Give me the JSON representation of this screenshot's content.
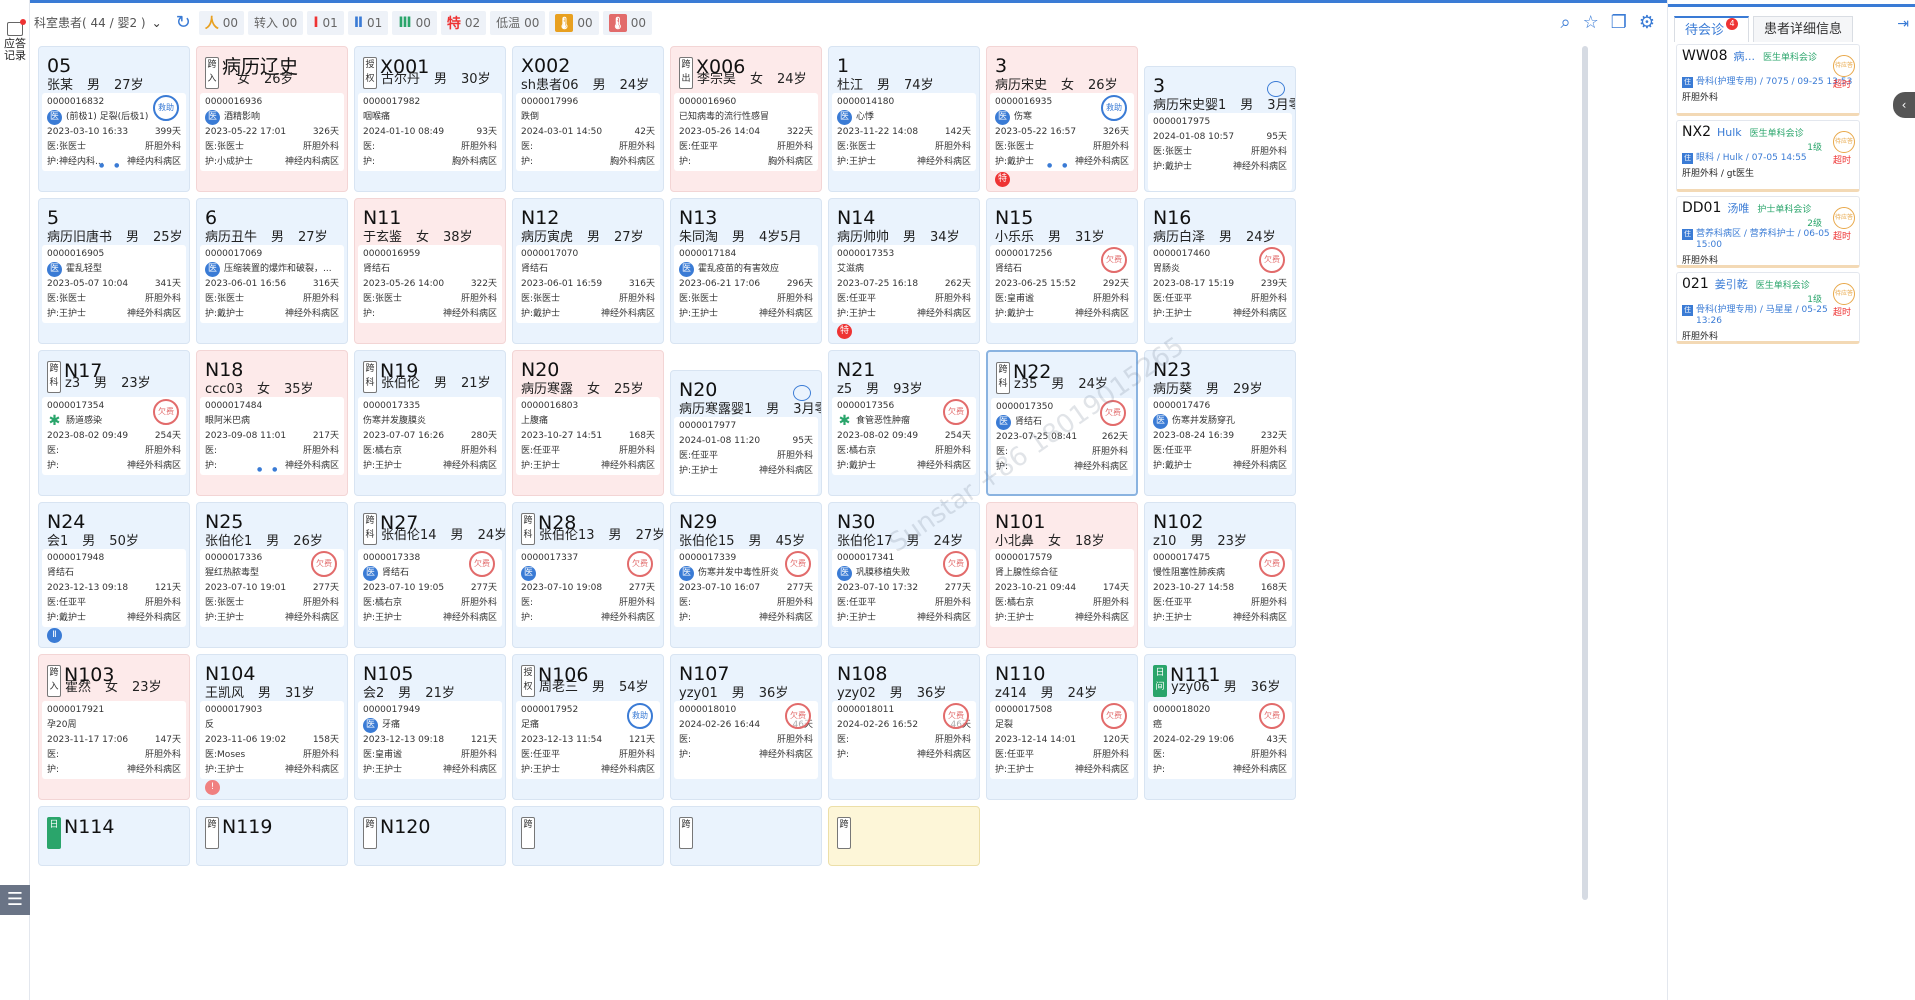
{
  "app": {
    "left_record_label": "应答记录",
    "filter_label": "科室患者( 44 / 婴2 )"
  },
  "stats": [
    {
      "icon": "人",
      "color": "#e8a020",
      "value": "00",
      "name": "stat-people"
    },
    {
      "label": "转入",
      "value": "00",
      "name": "stat-transfer-in"
    },
    {
      "icon": "Ⅰ",
      "color": "#e33",
      "value": "01",
      "name": "stat-level1"
    },
    {
      "icon": "Ⅱ",
      "color": "#3a7bd5",
      "value": "01",
      "name": "stat-level2"
    },
    {
      "icon": "Ⅲ",
      "color": "#2aa56b",
      "value": "00",
      "name": "stat-level3"
    },
    {
      "icon": "特",
      "color": "#e33",
      "value": "02",
      "name": "stat-special"
    },
    {
      "label": "低温",
      "value": "00",
      "name": "stat-low-temp"
    },
    {
      "icon": "🌡",
      "box": "#e8a020",
      "value": "00",
      "name": "stat-temp-yellow"
    },
    {
      "icon": "🌡",
      "box": "#e26b6b",
      "value": "00",
      "name": "stat-temp-red"
    }
  ],
  "right_panel": {
    "tab_pending": "待会诊",
    "tab_pending_badge": "4",
    "tab_detail": "患者详细信息",
    "consultations": [
      {
        "id": "WW08",
        "name": "病...",
        "type": "医生单科会诊",
        "level": "",
        "status": "待应答",
        "dept": "骨科(护理专用) / 7075 / 09-25 13:53",
        "overtime": "超时",
        "ward": "肝胆外科"
      },
      {
        "id": "NX2",
        "name": "Hulk",
        "type": "医生单科会诊",
        "level": "1级",
        "status": "待应答",
        "dept": "眼科 / Hulk / 07-05 14:55",
        "overtime": "超时",
        "ward": "肝胆外科 / gt医生"
      },
      {
        "id": "DD01",
        "name": "汤唯",
        "type": "护士单科会诊",
        "level": "2级",
        "status": "待应答",
        "dept": "营养科病区 / 营养科护士 / 06-05 15:00",
        "overtime": "超时",
        "ward": "肝胆外科"
      },
      {
        "id": "021",
        "name": "姜引乾",
        "type": "医生单科会诊",
        "level": "1级",
        "status": "待应答",
        "dept": "骨科(护理专用) / 马星星 / 05-25 13:26",
        "overtime": "超时",
        "ward": "肝胆外科"
      }
    ]
  },
  "watermark": "Sunstar +86 18019015265",
  "beds": [
    {
      "bed": "05",
      "name": "张某",
      "sex": "男",
      "age": "27岁",
      "id": "0000016832",
      "dx": "(前极1) 足裂(后极1)",
      "badge": "b",
      "date": "2023-03-10 16:33",
      "days": "399天",
      "doc": "张医士",
      "dept": "肝胆外科",
      "nurse": "神经内科...",
      "ward": "神经内科病区",
      "color": "blue",
      "stamp": "救助",
      "stampColor": "blue",
      "dots": true
    },
    {
      "bed": "病历辽史",
      "tag": "跨入",
      "name": "",
      "sex": "女",
      "age": "26岁",
      "id": "0000016936",
      "dx": "酒精影响",
      "badge": "b",
      "date": "2023-05-22 17:01",
      "days": "326天",
      "doc": "张医士",
      "dept": "肝胆外科",
      "nurse": "小成护士",
      "ward": "神经内科病区",
      "color": "pink"
    },
    {
      "bed": "X001",
      "tag": "授权",
      "tagGreen": false,
      "name": "古尔丹",
      "sex": "男",
      "age": "30岁",
      "id": "0000017982",
      "dx": "咽喉痛",
      "date": "2024-01-10 08:49",
      "days": "93天",
      "doc": "",
      "dept": "肝胆外科",
      "nurse": "",
      "ward": "胸外科病区",
      "color": "blue"
    },
    {
      "bed": "X002",
      "name": "sh患者06",
      "sex": "男",
      "age": "24岁",
      "id": "0000017996",
      "dx": "跌倒",
      "date": "2024-03-01 14:50",
      "days": "42天",
      "doc": "",
      "dept": "肝胆外科",
      "nurse": "",
      "ward": "胸外科病区",
      "color": "blue"
    },
    {
      "bed": "X006",
      "tag": "跨出",
      "name": "李宗昊",
      "sex": "女",
      "age": "24岁",
      "id": "0000016960",
      "dx": "已知病毒的流行性感冒",
      "date": "2023-05-26 14:04",
      "days": "322天",
      "doc": "任亚平",
      "dept": "肝胆外科",
      "nurse": "",
      "ward": "胸外科病区",
      "color": "pink"
    },
    {
      "bed": "1",
      "name": "杜江",
      "sex": "男",
      "age": "74岁",
      "id": "0000014180",
      "dx": "心悸",
      "badge": "b",
      "date": "2023-11-22 14:08",
      "days": "142天",
      "doc": "张医士",
      "dept": "肝胆外科",
      "nurse": "王护士",
      "ward": "神经外科病区",
      "color": "blue"
    },
    {
      "bed": "3",
      "name": "病历宋史",
      "sex": "女",
      "age": "26岁",
      "id": "0000016935",
      "dx": "伤寒",
      "badge": "b",
      "date": "2023-05-22 16:57",
      "days": "326天",
      "doc": "张医士",
      "dept": "肝胆外科",
      "nurse": "戴护士",
      "ward": "神经外科病区",
      "color": "pink",
      "stamp": "救助",
      "stampColor": "blue",
      "foot": "特",
      "footColor": "red",
      "dots": true
    },
    {
      "bed": "3",
      "name": "病历宋史婴1",
      "sex": "男",
      "age": "3月零4天",
      "id": "0000017975",
      "dx": "",
      "date": "2024-01-08 10:57",
      "days": "95天",
      "doc": "张医士",
      "dept": "肝胆外科",
      "nurse": "戴护士",
      "ward": "神经外科病区",
      "color": "blue",
      "baby": true,
      "offset": true
    },
    {
      "bed": "5",
      "name": "病历旧唐书",
      "sex": "男",
      "age": "25岁",
      "id": "0000016905",
      "dx": "霍乱轻型",
      "badge": "b",
      "date": "2023-05-07 10:04",
      "days": "341天",
      "doc": "张医士",
      "dept": "肝胆外科",
      "nurse": "王护士",
      "ward": "神经外科病区",
      "color": "blue"
    },
    {
      "bed": "6",
      "name": "病历丑牛",
      "sex": "男",
      "age": "27岁",
      "id": "0000017069",
      "dx": "压缩装置的爆炸和破裂，...",
      "badge": "b",
      "date": "2023-06-01 16:56",
      "days": "316天",
      "doc": "张医士",
      "dept": "肝胆外科",
      "nurse": "戴护士",
      "ward": "神经外科病区",
      "color": "blue"
    },
    {
      "bed": "N11",
      "name": "于玄鉴",
      "sex": "女",
      "age": "38岁",
      "id": "0000016959",
      "dx": "肾结石",
      "date": "2023-05-26 14:00",
      "days": "322天",
      "doc": "张医士",
      "dept": "肝胆外科",
      "nurse": "",
      "ward": "神经外科病区",
      "color": "pink"
    },
    {
      "bed": "N12",
      "name": "病历寅虎",
      "sex": "男",
      "age": "27岁",
      "id": "0000017070",
      "dx": "肾结石",
      "date": "2023-06-01 16:59",
      "days": "316天",
      "doc": "张医士",
      "dept": "肝胆外科",
      "nurse": "戴护士",
      "ward": "神经外科病区",
      "color": "blue"
    },
    {
      "bed": "N13",
      "name": "朱同淘",
      "sex": "男",
      "age": "4岁5月",
      "id": "0000017184",
      "dx": "霍乱疫苗的有害效应",
      "badge": "b",
      "date": "2023-06-21 17:06",
      "days": "296天",
      "doc": "张医士",
      "dept": "肝胆外科",
      "nurse": "王护士",
      "ward": "神经外科病区",
      "color": "blue"
    },
    {
      "bed": "N14",
      "name": "病历帅帅",
      "sex": "男",
      "age": "34岁",
      "id": "0000017353",
      "dx": "艾滋病",
      "date": "2023-07-25 16:18",
      "days": "262天",
      "doc": "任亚平",
      "dept": "肝胆外科",
      "nurse": "王护士",
      "ward": "神经外科病区",
      "color": "blue",
      "foot": "特",
      "footColor": "red"
    },
    {
      "bed": "N15",
      "name": "小乐乐",
      "sex": "男",
      "age": "31岁",
      "id": "0000017256",
      "dx": "肾结石",
      "date": "2023-06-25 15:52",
      "days": "292天",
      "doc": "皇甫谧",
      "dept": "肝胆外科",
      "nurse": "戴护士",
      "ward": "神经外科病区",
      "color": "blue",
      "stamp": "欠费"
    },
    {
      "bed": "N16",
      "name": "病历白泽",
      "sex": "男",
      "age": "24岁",
      "id": "0000017460",
      "dx": "胃肠炎",
      "date": "2023-08-17 15:19",
      "days": "239天",
      "doc": "任亚平",
      "dept": "肝胆外科",
      "nurse": "王护士",
      "ward": "神经外科病区",
      "color": "blue",
      "stamp": "欠费"
    },
    {
      "bed": "N17",
      "tag": "跨科",
      "name": "z3",
      "sex": "男",
      "age": "23岁",
      "id": "0000017354",
      "dx": "肠道感染",
      "badge": "g",
      "date": "2023-08-02 09:49",
      "days": "254天",
      "doc": "",
      "dept": "肝胆外科",
      "nurse": "",
      "ward": "神经外科病区",
      "color": "blue",
      "stamp": "欠费"
    },
    {
      "bed": "N18",
      "name": "ccc03",
      "sex": "女",
      "age": "35岁",
      "id": "0000017484",
      "dx": "眼阿米巴病",
      "date": "2023-09-08 11:01",
      "days": "217天",
      "doc": "",
      "dept": "肝胆外科",
      "nurse": "",
      "ward": "神经外科病区",
      "color": "pink",
      "dots": true
    },
    {
      "bed": "N19",
      "tag": "跨科",
      "name": "张伯伦",
      "sex": "男",
      "age": "21岁",
      "id": "0000017335",
      "dx": "伤寒并发腹膜炎",
      "date": "2023-07-07 16:26",
      "days": "280天",
      "doc": "橘右京",
      "dept": "肝胆外科",
      "nurse": "王护士",
      "ward": "神经外科病区",
      "color": "blue"
    },
    {
      "bed": "N20",
      "name": "病历寒露",
      "sex": "女",
      "age": "25岁",
      "id": "0000016803",
      "dx": "上腹痛",
      "date": "2023-10-27 14:51",
      "days": "168天",
      "doc": "任亚平",
      "dept": "肝胆外科",
      "nurse": "王护士",
      "ward": "神经外科病区",
      "color": "pink"
    },
    {
      "bed": "N20",
      "name": "病历寒露婴1",
      "sex": "男",
      "age": "3月零4天",
      "id": "0000017977",
      "dx": "",
      "date": "2024-01-08 11:20",
      "days": "95天",
      "doc": "任亚平",
      "dept": "肝胆外科",
      "nurse": "王护士",
      "ward": "神经外科病区",
      "color": "blue",
      "baby": true,
      "offset": true
    },
    {
      "bed": "N21",
      "name": "z5",
      "sex": "男",
      "age": "93岁",
      "id": "0000017356",
      "dx": "食管恶性肿瘤",
      "badge": "g",
      "date": "2023-08-02 09:49",
      "days": "254天",
      "doc": "橘右京",
      "dept": "肝胆外科",
      "nurse": "戴护士",
      "ward": "神经外科病区",
      "color": "blue",
      "stamp": "欠费"
    },
    {
      "bed": "N22",
      "tag": "跨科",
      "name": "z35",
      "sex": "男",
      "age": "24岁",
      "id": "0000017350",
      "dx": "肾结石",
      "badge": "b",
      "date": "2023-07-25 08:41",
      "days": "262天",
      "doc": "",
      "dept": "肝胆外科",
      "nurse": "",
      "ward": "神经外科病区",
      "color": "blue",
      "stamp": "欠费",
      "selected": true
    },
    {
      "bed": "N23",
      "name": "病历葵",
      "sex": "男",
      "age": "29岁",
      "id": "0000017476",
      "dx": "伤寒并发肠穿孔",
      "badge": "b",
      "date": "2023-08-24 16:39",
      "days": "232天",
      "doc": "任亚平",
      "dept": "肝胆外科",
      "nurse": "戴护士",
      "ward": "神经外科病区",
      "color": "blue"
    },
    {
      "bed": "N24",
      "name": "会1",
      "sex": "男",
      "age": "50岁",
      "id": "0000017948",
      "dx": "肾结石",
      "date": "2023-12-13 09:18",
      "days": "121天",
      "doc": "任亚平",
      "dept": "肝胆外科",
      "nurse": "戴护士",
      "ward": "神经外科病区",
      "color": "blue",
      "foot": "Ⅱ",
      "footColor": "blue"
    },
    {
      "bed": "N25",
      "name": "张伯伦1",
      "sex": "男",
      "age": "26岁",
      "id": "0000017336",
      "dx": "猩红热脓毒型",
      "date": "2023-07-10 19:01",
      "days": "277天",
      "doc": "张医士",
      "dept": "肝胆外科",
      "nurse": "王护士",
      "ward": "神经外科病区",
      "color": "blue",
      "stamp": "欠费"
    },
    {
      "bed": "N27",
      "tag": "跨科",
      "name": "张伯伦14",
      "sex": "男",
      "age": "24岁",
      "id": "0000017338",
      "dx": "肾结石",
      "badge": "b",
      "date": "2023-07-10 19:05",
      "days": "277天",
      "doc": "橘右京",
      "dept": "肝胆外科",
      "nurse": "王护士",
      "ward": "神经外科病区",
      "color": "blue",
      "stamp": "欠费"
    },
    {
      "bed": "N28",
      "tag": "跨科",
      "name": "张伯伦13",
      "sex": "男",
      "age": "27岁",
      "id": "0000017337",
      "dx": "",
      "badge": "b",
      "date": "2023-07-10 19:08",
      "days": "277天",
      "doc": "",
      "dept": "肝胆外科",
      "nurse": "",
      "ward": "神经外科病区",
      "color": "blue",
      "stamp": "欠费"
    },
    {
      "bed": "N29",
      "name": "张伯伦15",
      "sex": "男",
      "age": "45岁",
      "id": "0000017339",
      "dx": "伤寒并发中毒性肝炎",
      "badge": "b",
      "date": "2023-07-10 16:07",
      "days": "277天",
      "doc": "",
      "dept": "肝胆外科",
      "nurse": "",
      "ward": "神经外科病区",
      "color": "blue",
      "stamp": "欠费"
    },
    {
      "bed": "N30",
      "name": "张伯伦17",
      "sex": "男",
      "age": "24岁",
      "id": "0000017341",
      "dx": "巩膜移植失败",
      "badge": "b",
      "date": "2023-07-10 17:32",
      "days": "277天",
      "doc": "任亚平",
      "dept": "肝胆外科",
      "nurse": "王护士",
      "ward": "神经外科病区",
      "color": "blue",
      "stamp": "欠费"
    },
    {
      "bed": "N101",
      "name": "小北鼻",
      "sex": "女",
      "age": "18岁",
      "id": "0000017579",
      "dx": "肾上腺性综合征",
      "date": "2023-10-21 09:44",
      "days": "174天",
      "doc": "橘右京",
      "dept": "肝胆外科",
      "nurse": "王护士",
      "ward": "神经外科病区",
      "color": "pink"
    },
    {
      "bed": "N102",
      "name": "z10",
      "sex": "男",
      "age": "23岁",
      "id": "0000017475",
      "dx": "慢性阻塞性肺疾病",
      "date": "2023-10-27 14:58",
      "days": "168天",
      "doc": "任亚平",
      "dept": "肝胆外科",
      "nurse": "王护士",
      "ward": "神经外科病区",
      "color": "blue",
      "stamp": "欠费"
    },
    {
      "bed": "N103",
      "tag": "跨入",
      "name": "霍然",
      "sex": "女",
      "age": "23岁",
      "id": "0000017921",
      "dx": "孕20周",
      "date": "2023-11-17 17:06",
      "days": "147天",
      "doc": "",
      "dept": "肝胆外科",
      "nurse": "",
      "ward": "神经外科病区",
      "color": "pink"
    },
    {
      "bed": "N104",
      "name": "王凯风",
      "sex": "男",
      "age": "31岁",
      "id": "0000017903",
      "dx": "反",
      "date": "2023-11-06 19:02",
      "days": "158天",
      "doc": "Moses",
      "dept": "肝胆外科",
      "nurse": "王护士",
      "ward": "神经外科病区",
      "color": "blue",
      "foot": "!",
      "footColor": "pink"
    },
    {
      "bed": "N105",
      "name": "会2",
      "sex": "男",
      "age": "21岁",
      "id": "0000017949",
      "dx": "牙痛",
      "badge": "b",
      "date": "2023-12-13 09:18",
      "days": "121天",
      "doc": "皇甫谧",
      "dept": "肝胆外科",
      "nurse": "王护士",
      "ward": "神经外科病区",
      "color": "blue"
    },
    {
      "bed": "N106",
      "tag": "授权",
      "name": "周老三",
      "sex": "男",
      "age": "54岁",
      "id": "0000017952",
      "dx": "足痛",
      "date": "2023-12-13 11:54",
      "days": "121天",
      "doc": "任亚平",
      "dept": "肝胆外科",
      "nurse": "王护士",
      "ward": "神经外科病区",
      "color": "blue",
      "stamp": "救助",
      "stampColor": "blue"
    },
    {
      "bed": "N107",
      "name": "yzy01",
      "sex": "男",
      "age": "36岁",
      "id": "0000018010",
      "dx": "",
      "date": "2024-02-26 16:44",
      "days": "46天",
      "doc": "",
      "dept": "肝胆外科",
      "nurse": "",
      "ward": "神经外科病区",
      "color": "blue",
      "stamp": "欠费"
    },
    {
      "bed": "N108",
      "name": "yzy02",
      "sex": "男",
      "age": "36岁",
      "id": "0000018011",
      "dx": "",
      "date": "2024-02-26 16:52",
      "days": "46天",
      "doc": "",
      "dept": "肝胆外科",
      "nurse": "",
      "ward": "神经外科病区",
      "color": "blue",
      "stamp": "欠费"
    },
    {
      "bed": "N110",
      "name": "z414",
      "sex": "男",
      "age": "24岁",
      "id": "0000017508",
      "dx": "足裂",
      "date": "2023-12-14 14:01",
      "days": "120天",
      "doc": "任亚平",
      "dept": "肝胆外科",
      "nurse": "王护士",
      "ward": "神经外科病区",
      "color": "blue",
      "stamp": "欠费"
    },
    {
      "bed": "N111",
      "tag": "日间",
      "tagGreen": true,
      "name": "yzy06",
      "sex": "男",
      "age": "36岁",
      "id": "0000018020",
      "dx": "癌",
      "date": "2024-02-29 19:06",
      "days": "43天",
      "doc": "",
      "dept": "肝胆外科",
      "nurse": "",
      "ward": "神经外科病区",
      "color": "blue",
      "stamp": "欠费"
    },
    {
      "bed": "N114",
      "tag": "日",
      "tagGreen": true,
      "name": "",
      "sex": "",
      "age": "",
      "id": "",
      "dx": "",
      "date": "",
      "days": "",
      "doc": "",
      "dept": "",
      "nurse": "",
      "ward": "",
      "color": "blue"
    },
    {
      "bed": "N119",
      "tag": "跨",
      "name": "",
      "sex": "",
      "age": "",
      "id": "",
      "dx": "",
      "date": "",
      "days": "",
      "doc": "",
      "dept": "",
      "nurse": "",
      "ward": "",
      "color": "blue"
    },
    {
      "bed": "N120",
      "tag": "跨",
      "name": "",
      "sex": "",
      "age": "",
      "id": "",
      "dx": "",
      "date": "",
      "days": "",
      "doc": "",
      "dept": "",
      "nurse": "",
      "ward": "",
      "color": "blue"
    },
    {
      "bed": "",
      "tag": "跨",
      "name": "",
      "sex": "",
      "age": "",
      "id": "",
      "dx": "",
      "date": "",
      "days": "",
      "doc": "",
      "dept": "",
      "nurse": "",
      "ward": "",
      "color": "blue"
    },
    {
      "bed": "",
      "tag": "跨",
      "name": "",
      "sex": "",
      "age": "",
      "id": "",
      "dx": "",
      "date": "",
      "days": "",
      "doc": "",
      "dept": "",
      "nurse": "",
      "ward": "",
      "color": "blue"
    },
    {
      "bed": "",
      "tag": "跨",
      "name": "",
      "sex": "",
      "age": "",
      "id": "",
      "dx": "",
      "date": "",
      "days": "",
      "doc": "",
      "dept": "",
      "nurse": "",
      "ward": "",
      "color": "yel"
    }
  ],
  "labels": {
    "doc": "医:",
    "nurse": "护:"
  }
}
